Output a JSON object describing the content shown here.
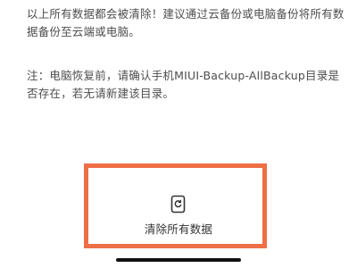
{
  "info": {
    "warning_text": "以上所有数据都会被清除！建议通过云备份或电脑备份将所有数据备份至云端或电脑。",
    "note_text": "注：电脑恢复前，请确认手机MIUI-Backup-AllBackup目录是否存在，若无请新建该目录。"
  },
  "action": {
    "erase_label": "清除所有数据",
    "icon": "phone-reset-icon"
  },
  "colors": {
    "highlight_border": "#ee6f47",
    "text": "#4d4d4d"
  }
}
